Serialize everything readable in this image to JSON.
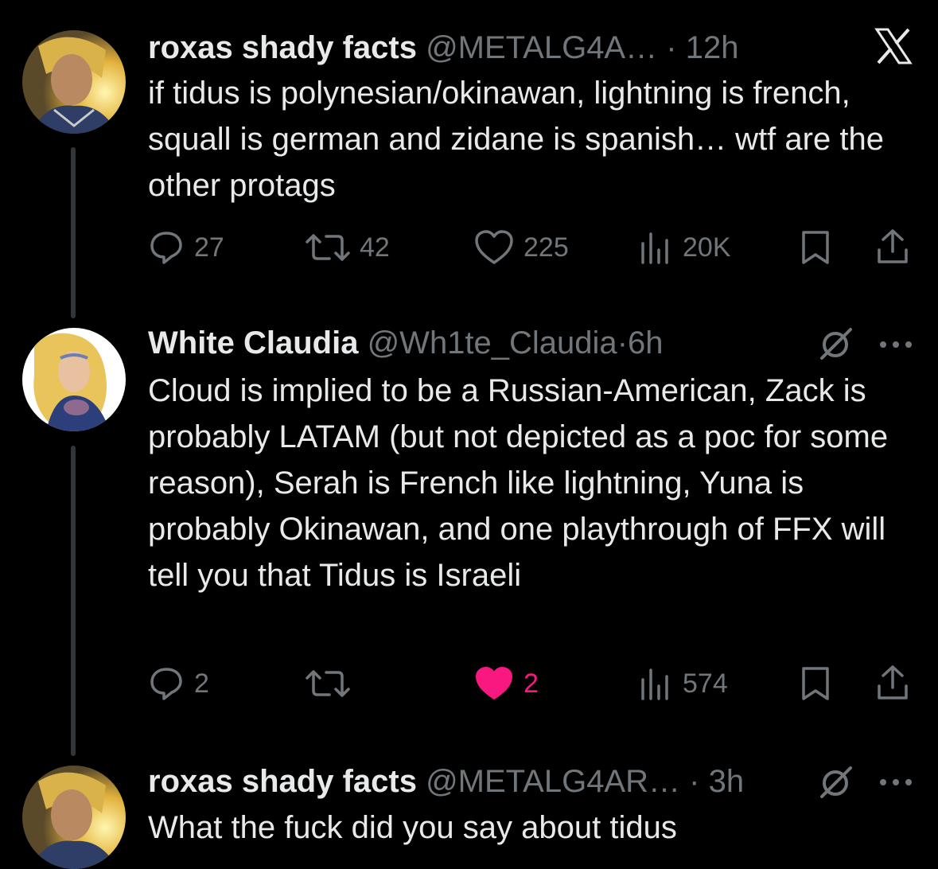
{
  "posts": [
    {
      "display_name": "roxas shady facts",
      "handle": "@METALG4A…",
      "separator": "·",
      "time": "12h",
      "text": "if tidus is polynesian/okinawan, lightning is french, squall is german and zidane is spanish… wtf are the other protags",
      "replies": "27",
      "reposts": "42",
      "likes": "225",
      "views": "20K"
    },
    {
      "display_name": "White Claudia",
      "handle": "@Wh1te_Claudia",
      "separator": "·",
      "time": "6h",
      "text": "Cloud is implied to be a Russian-American, Zack is probably LATAM (but not depicted as a poc for some reason), Serah is French like lightning, Yuna is probably Okinawan, and one playthrough of FFX will tell you that Tidus is Israeli",
      "replies": "2",
      "reposts": "",
      "likes": "2",
      "liked": true,
      "views": "574"
    },
    {
      "display_name": "roxas shady facts",
      "handle": "@METALG4AR…",
      "separator": "·",
      "time": "3h",
      "text": "What the fuck did you say about tidus"
    }
  ],
  "colors": {
    "like_active": "#f91880",
    "muted": "#71767b",
    "text": "#e7e9ea"
  },
  "icons": [
    "x-logo-icon",
    "grok-icon",
    "more-icon",
    "reply-icon",
    "repost-icon",
    "like-icon",
    "views-icon",
    "bookmark-icon",
    "share-icon"
  ]
}
